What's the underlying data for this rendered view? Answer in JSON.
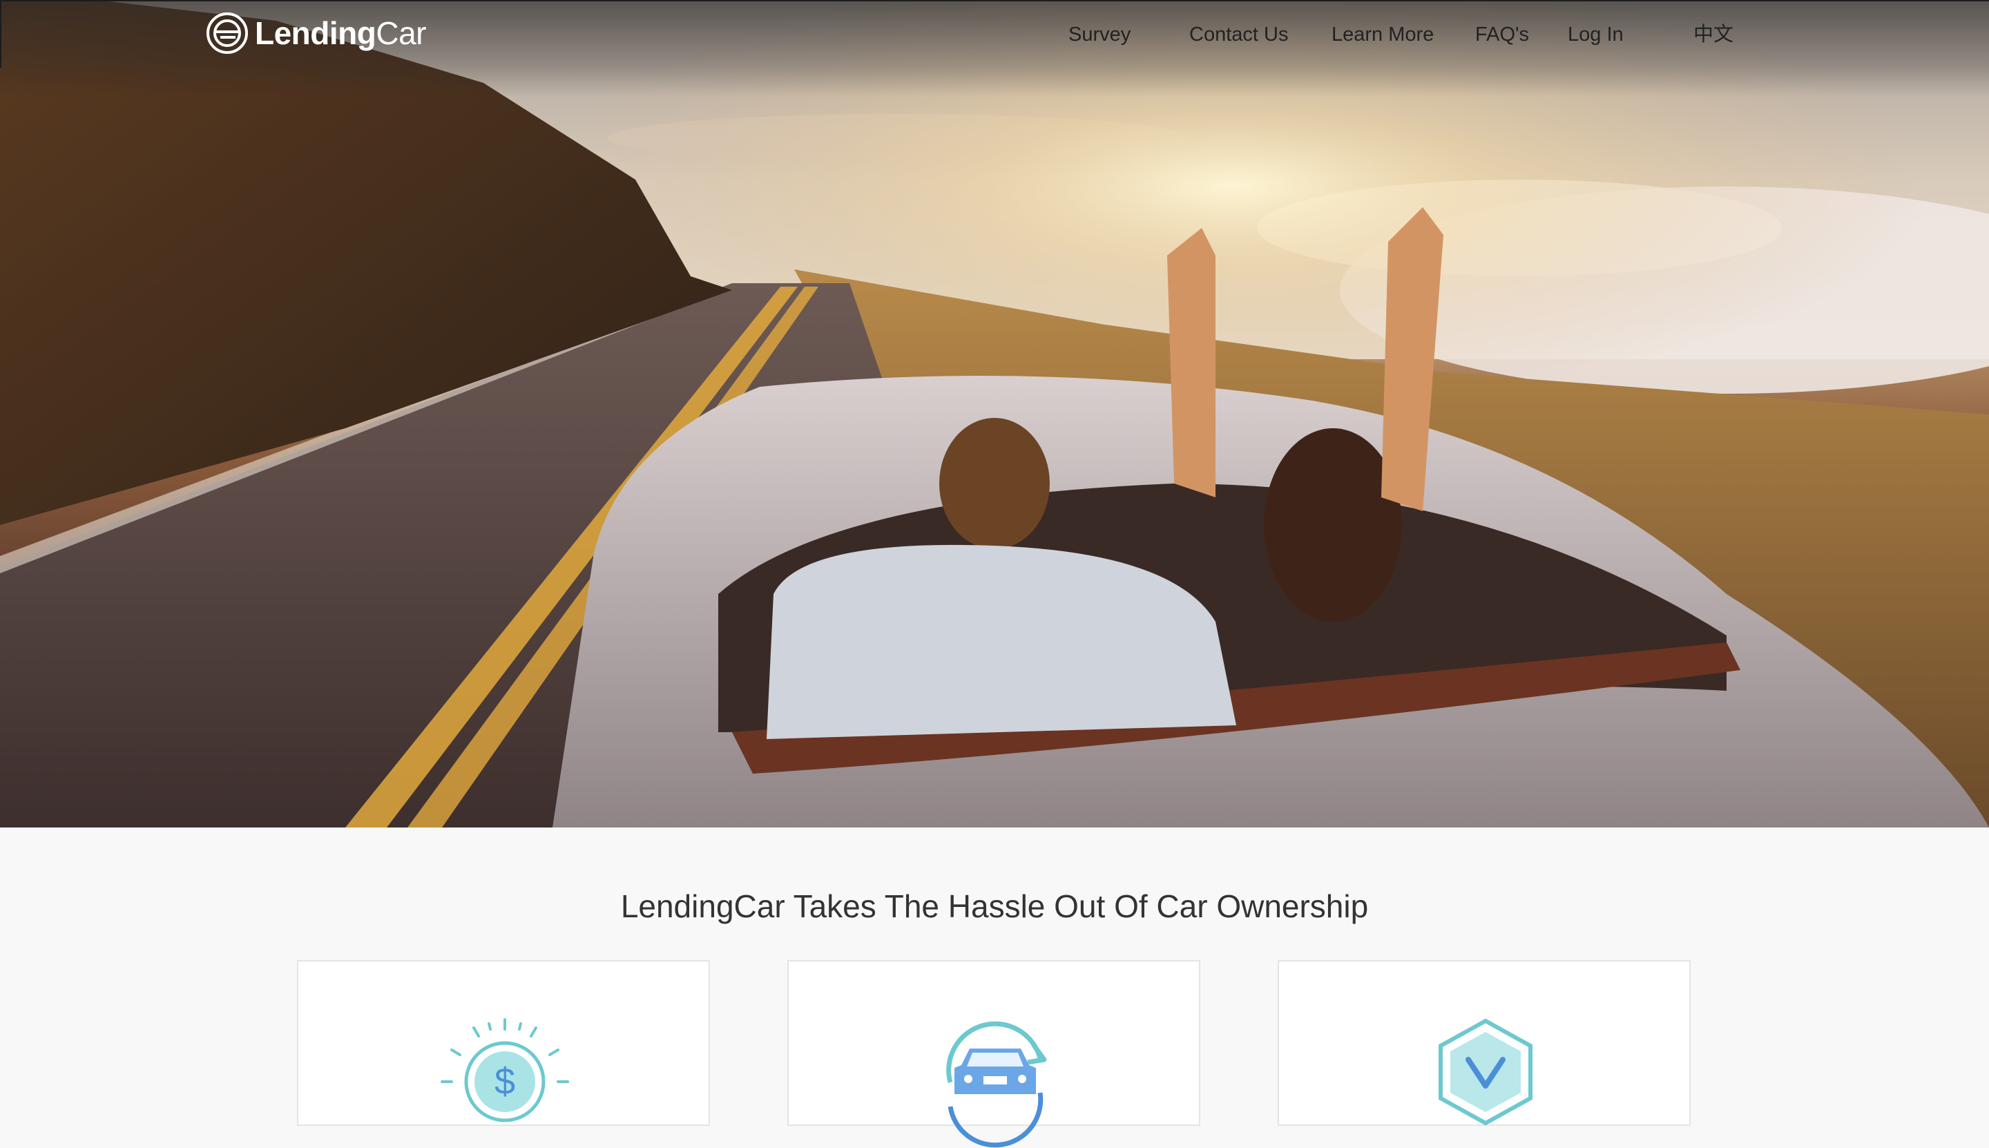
{
  "brand": {
    "name_bold": "Lending",
    "name_light": "Car"
  },
  "nav": {
    "items": [
      {
        "label": "Survey"
      },
      {
        "label": "Contact Us"
      },
      {
        "label": "Learn More"
      },
      {
        "label": "FAQ's"
      },
      {
        "label": "Log In"
      },
      {
        "label": "中文"
      }
    ]
  },
  "hero": {
    "image": "couple-in-convertible-sunset-photo"
  },
  "main": {
    "headline": "LendingCar Takes The Hassle Out Of Car Ownership",
    "features": [
      {
        "icon": "dollar-coin-icon"
      },
      {
        "icon": "car-refresh-icon"
      },
      {
        "icon": "hexagon-check-icon"
      }
    ]
  },
  "colors": {
    "accent_teal": "#6cc9cf",
    "accent_blue": "#4a8fd8",
    "text_dark": "#333333"
  }
}
